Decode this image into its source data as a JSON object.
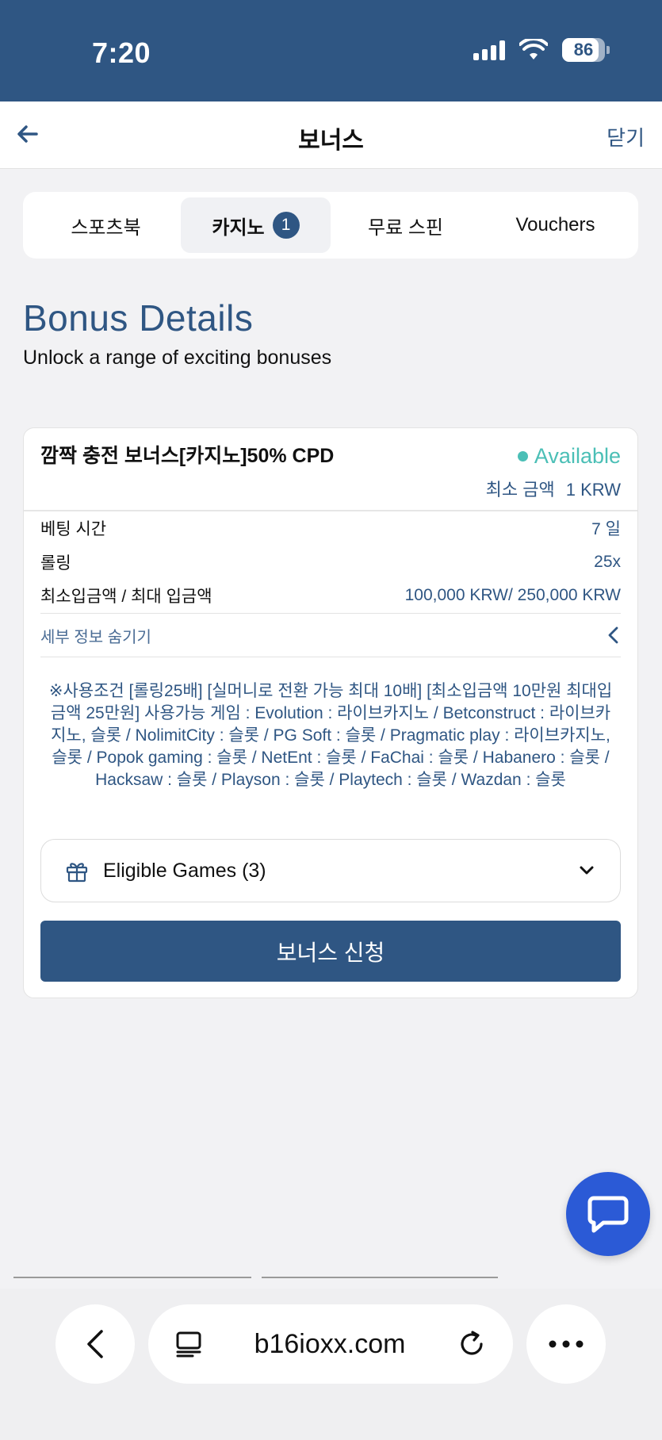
{
  "status_bar": {
    "time": "7:20",
    "battery": "86",
    "battery_level": 0.86
  },
  "nav": {
    "title": "보너스",
    "close_label": "닫기"
  },
  "tabs": [
    {
      "label": "스포츠북",
      "active": false
    },
    {
      "label": "카지노",
      "active": true,
      "badge": "1"
    },
    {
      "label": "무료 스핀",
      "active": false
    },
    {
      "label": "Vouchers",
      "active": false
    }
  ],
  "section": {
    "title": "Bonus Details",
    "subtitle": "Unlock a range of exciting bonuses"
  },
  "bonus": {
    "title": "깜짝 충전 보너스[카지노]50% CPD",
    "status": "Available",
    "min_amount_label": "최소 금액",
    "min_amount_value": "1 KRW",
    "rows": [
      {
        "label": "베팅 시간",
        "value": "7 일"
      },
      {
        "label": "롤링",
        "value": "25x"
      },
      {
        "label": "최소입금액 / 최대 입금액",
        "value": "100,000 KRW/ 250,000 KRW"
      }
    ],
    "details_toggle": "세부 정보 숨기기",
    "terms": "※사용조건 [롤링25배] [실머니로 전환 가능 최대 10배] [최소입금액 10만원 최대입금액 25만원] 사용가능 게임 : Evolution : 라이브카지노 / Betconstruct : 라이브카지노, 슬롯 / NolimitCity : 슬롯 / PG Soft : 슬롯 / Pragmatic play : 라이브카지노, 슬롯 / Popok gaming : 슬롯 / NetEnt : 슬롯 / FaChai : 슬롯 / Habanero : 슬롯 / Hacksaw : 슬롯 / Playson : 슬롯 / Playtech : 슬롯 / Wazdan : 슬롯",
    "eligible_games": "Eligible Games (3)",
    "apply_label": "보너스 신청"
  },
  "browser": {
    "domain": "b16ioxx.com"
  },
  "colors": {
    "brand": "#2f5683",
    "available": "#4bbfb6",
    "chat": "#2b5ad6"
  },
  "icons": {
    "back": "arrow-left-icon",
    "toggle": "chevron-left-icon",
    "gift": "gift-icon",
    "dropdown": "chevron-down-icon",
    "chat": "chat-bubble-icon",
    "reader": "reader-mode-icon",
    "reload": "reload-icon",
    "more": "more-dots-icon"
  }
}
